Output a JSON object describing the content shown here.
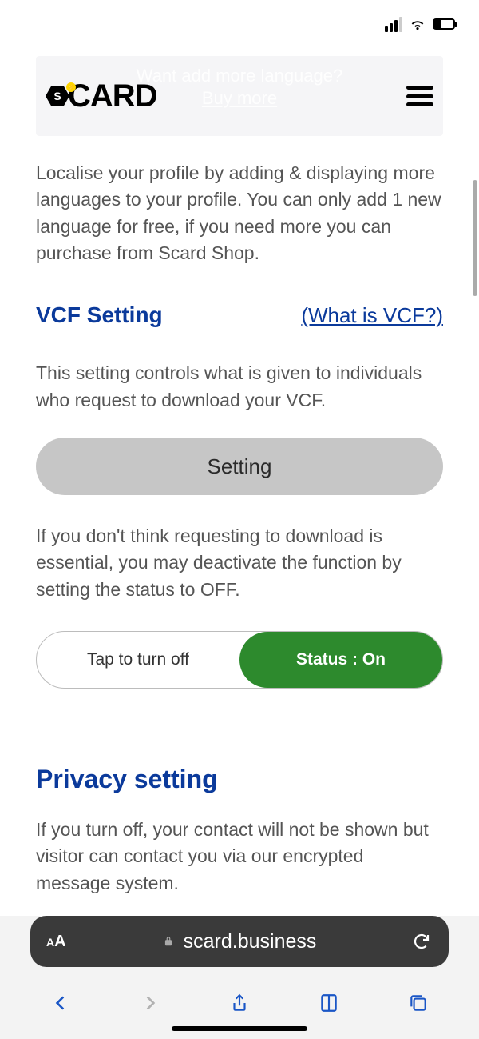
{
  "nav": {
    "logo_text": "CARD",
    "banner_line1": "Want add more language?",
    "banner_line2": "Buy more"
  },
  "intro": {
    "text": "Localise your profile by adding & displaying more languages to your profile. You can only add 1 new language for free, if you need more you can purchase from Scard Shop."
  },
  "vcf": {
    "title": "VCF Setting",
    "hint": "(What is VCF?)",
    "desc": "This setting controls what is given to individuals who request to download your VCF.",
    "button_label": "Setting",
    "note": "If you don't think requesting to download is essential, you may deactivate the function by setting the status to OFF.",
    "toggle_off_label": "Tap to turn off",
    "toggle_on_label": "Status : On"
  },
  "privacy": {
    "title": "Privacy setting",
    "desc": "If you turn off, your contact will not be shown but visitor can contact you via our encrypted message system."
  },
  "browser": {
    "url": "scard.business",
    "aa_small": "A",
    "aa_big": "A"
  }
}
